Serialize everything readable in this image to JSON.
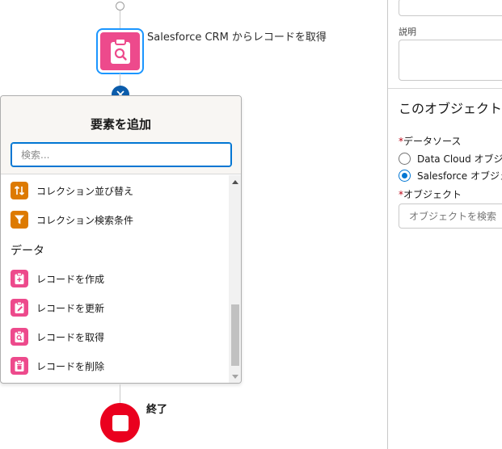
{
  "flow": {
    "get_node_label": "Salesforce CRM からレコードを取得",
    "end_label": "終了"
  },
  "popover": {
    "title": "要素を追加",
    "search_placeholder": "検索...",
    "items_top": [
      {
        "label": "コレクション並び替え",
        "icon": "sort-icon",
        "color": "#dd7a01"
      },
      {
        "label": "コレクション検索条件",
        "icon": "filter-icon",
        "color": "#dd7a01"
      }
    ],
    "section_label": "データ",
    "data_items": [
      {
        "label": "レコードを作成",
        "icon": "create-record-icon",
        "color": "#ed4a8c"
      },
      {
        "label": "レコードを更新",
        "icon": "update-record-icon",
        "color": "#ed4a8c"
      },
      {
        "label": "レコードを取得",
        "icon": "get-record-icon",
        "color": "#ed4a8c"
      },
      {
        "label": "レコードを削除",
        "icon": "delete-record-icon",
        "color": "#ed4a8c"
      }
    ]
  },
  "panel": {
    "description_label": "説明",
    "section_title": "このオブジェクト",
    "data_source_label": "データソース",
    "radio_options": [
      {
        "label": "Data Cloud オブジェ",
        "selected": false
      },
      {
        "label": "Salesforce オブジェ",
        "selected": true
      }
    ],
    "object_label": "オブジェクト",
    "object_placeholder": "オブジェクトを検索"
  },
  "colors": {
    "accent": "#0176d3",
    "record_pink": "#ed4a8c",
    "logic_orange": "#dd7a01",
    "end_red": "#ea001e"
  }
}
